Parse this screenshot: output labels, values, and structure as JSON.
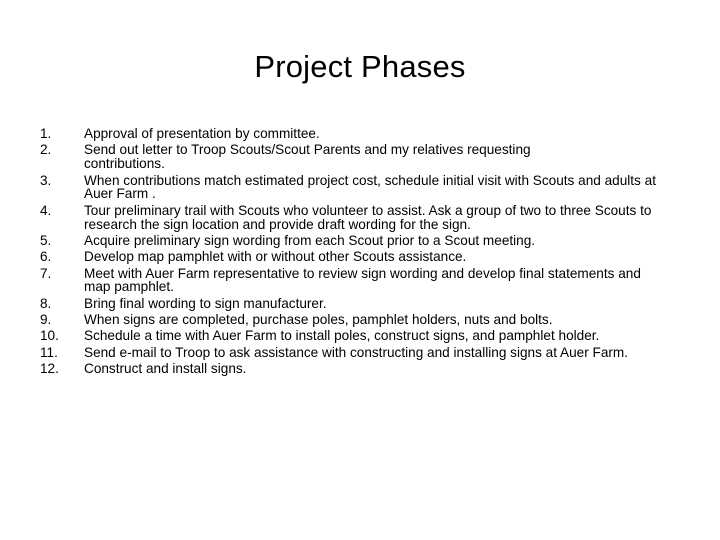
{
  "slide": {
    "title": "Project Phases",
    "items": [
      {
        "number": "1.",
        "text": "Approval of presentation by committee."
      },
      {
        "number": "2.",
        "text": "Send out letter to Troop Scouts/Scout Parents and my relatives requesting contributions."
      },
      {
        "number": "3.",
        "text": "When contributions match estimated project cost, schedule initial visit with Scouts and adults at Auer Farm ."
      },
      {
        "number": "4.",
        "text": "Tour preliminary trail with Scouts who volunteer to assist.  Ask a group of two to three Scouts to research the sign location and provide draft wording for the sign."
      },
      {
        "number": "5.",
        "text": "Acquire preliminary sign wording from each  Scout prior to a Scout meeting."
      },
      {
        "number": "6.",
        "text": "Develop map pamphlet with or without other Scouts assistance."
      },
      {
        "number": "7.",
        "text": "Meet with Auer Farm representative to review sign wording and develop final statements and map pamphlet."
      },
      {
        "number": "8.",
        "text": "Bring final wording to sign manufacturer."
      },
      {
        "number": "9.",
        "text": "When signs are completed, purchase poles, pamphlet holders, nuts and bolts."
      },
      {
        "number": "10.",
        "text": "Schedule a time with Auer Farm to install poles, construct signs, and pamphlet holder."
      },
      {
        "number": "11.",
        "text": "Send e-mail to Troop to ask assistance with constructing and installing signs at Auer Farm."
      },
      {
        "number": "12.",
        "text": "Construct and install signs."
      }
    ]
  }
}
